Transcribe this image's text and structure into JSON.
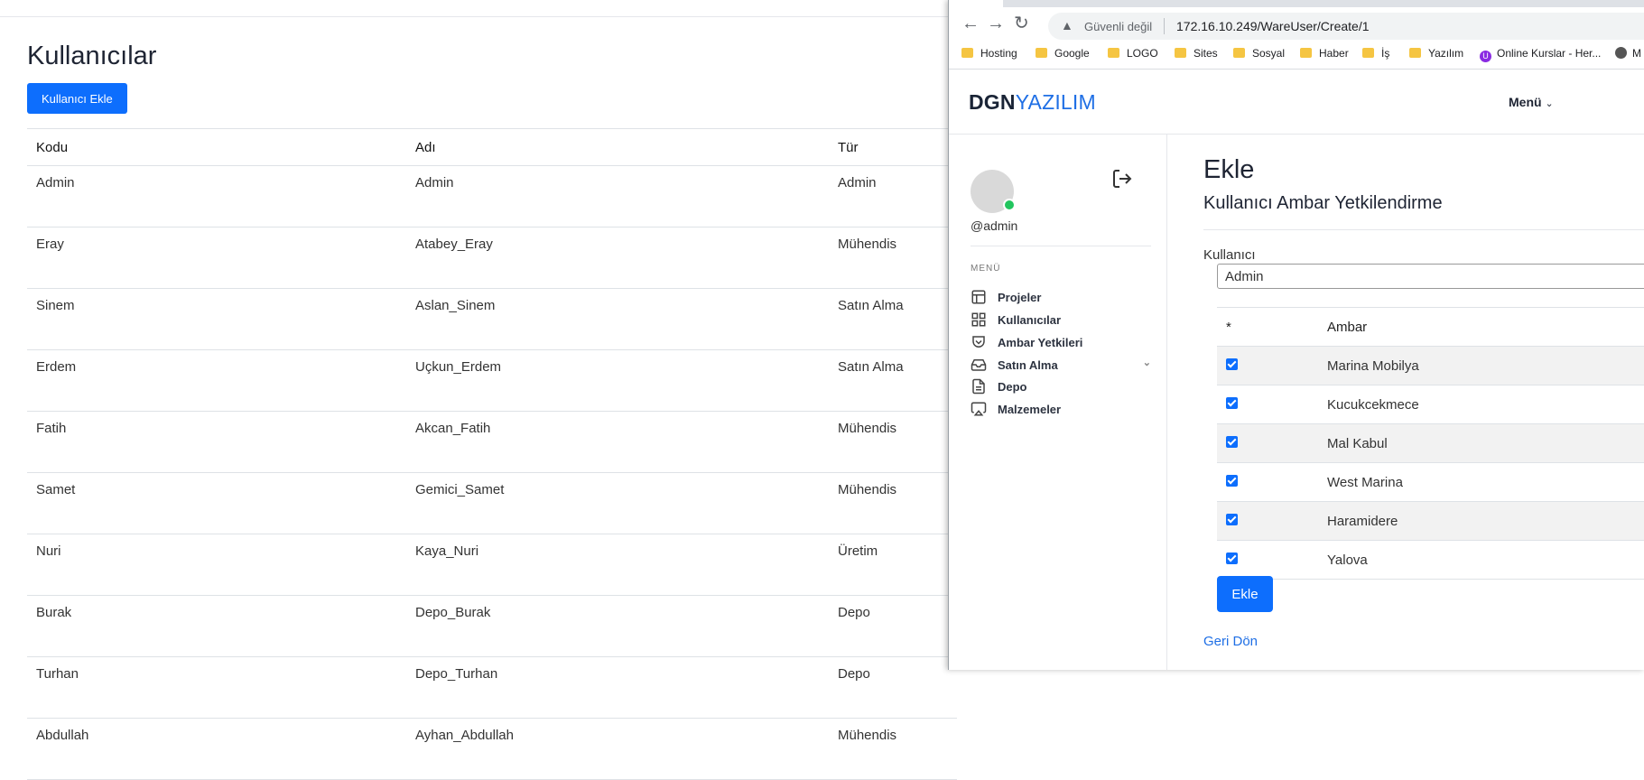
{
  "background_page": {
    "title": "Kullanıcılar",
    "add_button": "Kullanıcı Ekle",
    "columns": [
      "Kodu",
      "Adı",
      "Tür"
    ],
    "rows": [
      [
        "Admin",
        "Admin",
        "Admin"
      ],
      [
        "Eray",
        "Atabey_Eray",
        "Mühendis"
      ],
      [
        "Sinem",
        "Aslan_Sinem",
        "Satın Alma"
      ],
      [
        "Erdem",
        "Uçkun_Erdem",
        "Satın Alma"
      ],
      [
        "Fatih",
        "Akcan_Fatih",
        "Mühendis"
      ],
      [
        "Samet",
        "Gemici_Samet",
        "Mühendis"
      ],
      [
        "Nuri",
        "Kaya_Nuri",
        "Üretim"
      ],
      [
        "Burak",
        "Depo_Burak",
        "Depo"
      ],
      [
        "Turhan",
        "Depo_Turhan",
        "Depo"
      ],
      [
        "Abdullah",
        "Ayhan_Abdullah",
        "Mühendis"
      ]
    ]
  },
  "browser": {
    "security_text": "Güvenli değil",
    "url": "172.16.10.249/WareUser/Create/1",
    "bookmarks": [
      "Hosting",
      "Google",
      "LOGO",
      "Sites",
      "Sosyal",
      "Haber",
      "İş",
      "Yazılım",
      "Online Kurslar - Her...",
      "M"
    ]
  },
  "app": {
    "brand_bold": "DGN",
    "brand_light": "YAZILIM",
    "menu_label": "Menü",
    "user": {
      "handle": "@admin"
    },
    "sidebar_label": "MENÜ",
    "sidebar_items": [
      {
        "label": "Projeler",
        "icon": "layout-icon"
      },
      {
        "label": "Kullanıcılar",
        "icon": "grid-icon"
      },
      {
        "label": "Ambar Yetkileri",
        "icon": "shield-icon"
      },
      {
        "label": "Satın Alma",
        "icon": "inbox-icon"
      },
      {
        "label": "Depo",
        "icon": "document-icon"
      },
      {
        "label": "Malzemeler",
        "icon": "airplay-icon"
      }
    ],
    "heading": "Ekle",
    "subheading": "Kullanıcı Ambar Yetkilendirme",
    "user_field_label": "Kullanıcı",
    "user_field_value": "Admin",
    "table_headers": [
      "*",
      "Ambar"
    ],
    "warehouses": [
      {
        "name": "Marina Mobilya",
        "checked": true
      },
      {
        "name": "Kucukcekmece",
        "checked": true
      },
      {
        "name": "Mal Kabul",
        "checked": true
      },
      {
        "name": "West Marina",
        "checked": true
      },
      {
        "name": "Haramidere",
        "checked": true
      },
      {
        "name": "Yalova",
        "checked": true
      }
    ],
    "submit_label": "Ekle",
    "back_link": "Geri Dön",
    "accent_color": "#0d6efd"
  }
}
